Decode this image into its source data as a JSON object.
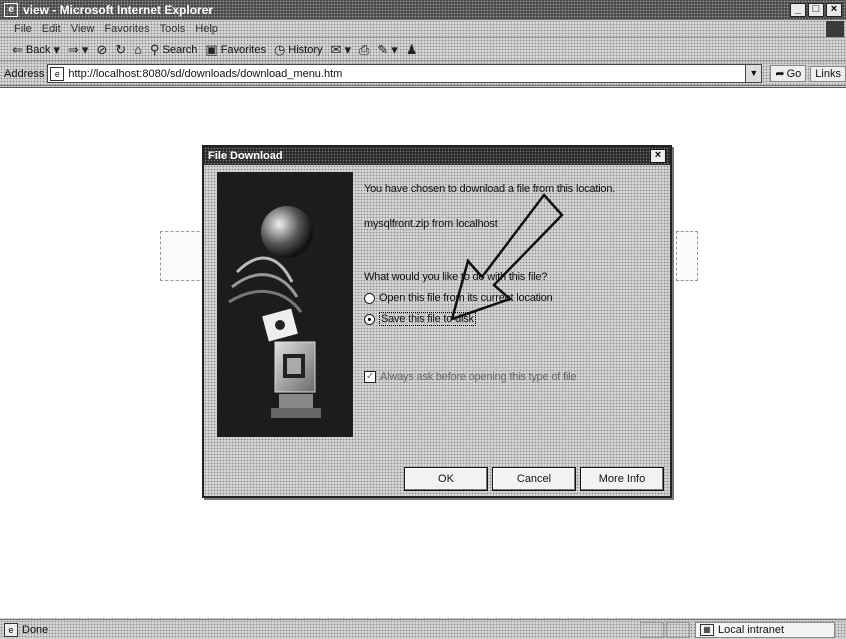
{
  "window": {
    "title": "view - Microsoft Internet Explorer",
    "controls": [
      "_",
      "□",
      "×"
    ]
  },
  "menu": [
    "File",
    "Edit",
    "View",
    "Favorites",
    "Tools",
    "Help"
  ],
  "toolbar": {
    "back": "Back",
    "search": "Search",
    "favorites": "Favorites",
    "history": "History"
  },
  "address": {
    "label": "Address",
    "url": "http://localhost:8080/sd/downloads/download_menu.htm",
    "go": "Go",
    "links": "Links"
  },
  "dialog": {
    "title": "File Download",
    "intro": "You have chosen to download a file from this location.",
    "filename": "mysqlfront.zip from localhost",
    "question": "What would you like to do with this file?",
    "option_open": "Open this file from its current location",
    "option_save": "Save this file to disk",
    "selected_option": "save",
    "checkbox_label": "Always ask before opening this type of file",
    "checkbox_checked": true,
    "ok": "OK",
    "cancel": "Cancel",
    "more_info": "More Info"
  },
  "status": {
    "text": "Done",
    "zone": "Local intranet"
  },
  "colors": {
    "title_bg": "#2a2a2a",
    "content_bg": "#ffffff",
    "chrome_bg": "#d4d4d4"
  }
}
